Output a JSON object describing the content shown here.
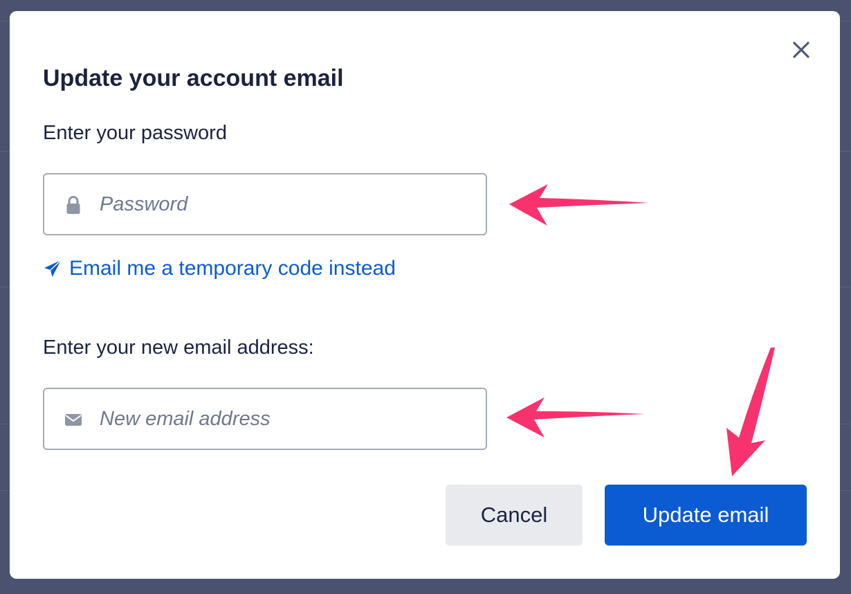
{
  "dialog": {
    "title": "Update your account email",
    "close_icon": "close-icon"
  },
  "password_section": {
    "label": "Enter your password",
    "placeholder": "Password",
    "value": "",
    "icon": "lock-icon"
  },
  "temp_code_link": {
    "label": "Email me a temporary code instead",
    "icon": "paper-plane-icon"
  },
  "email_section": {
    "label": "Enter your new email address:",
    "placeholder": "New email address",
    "value": "",
    "icon": "envelope-icon"
  },
  "actions": {
    "cancel_label": "Cancel",
    "submit_label": "Update email"
  },
  "colors": {
    "primary": "#0b5bd3",
    "annotation_arrow": "#f7326f",
    "overlay": "#4b5270",
    "heading_text": "#1b2340"
  }
}
